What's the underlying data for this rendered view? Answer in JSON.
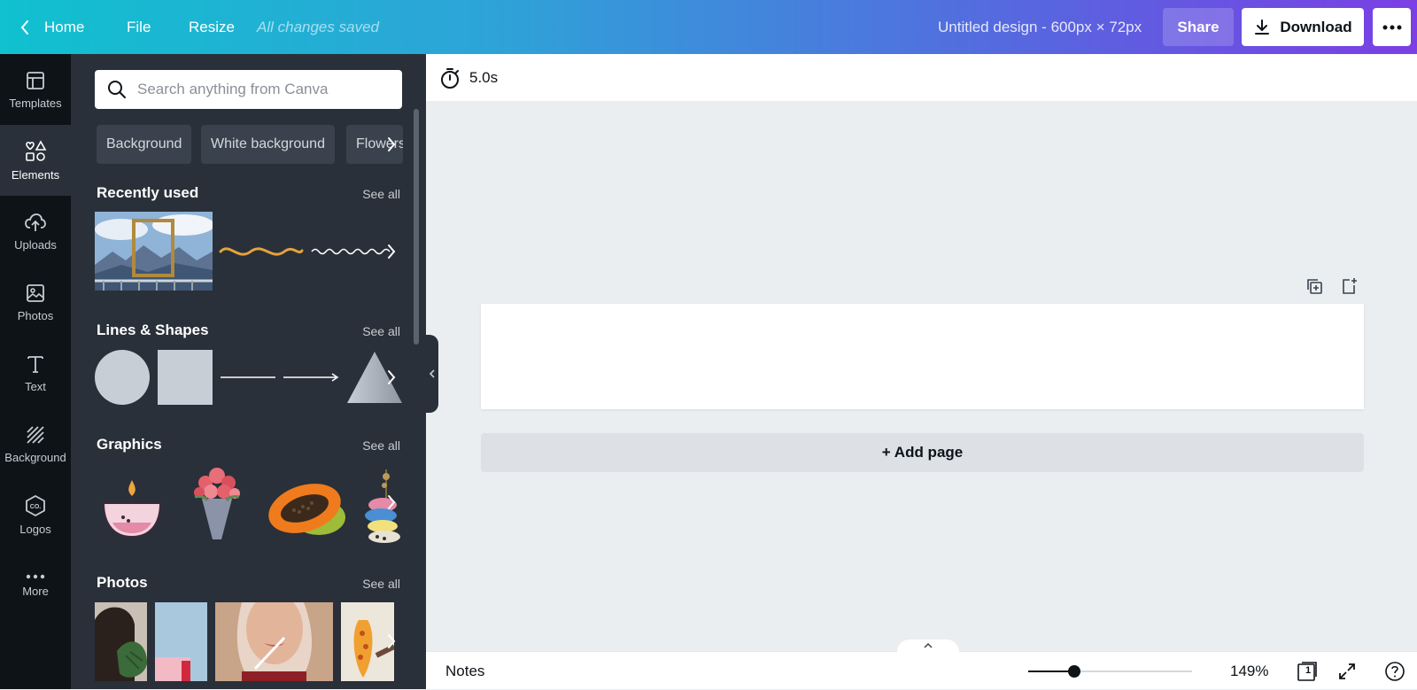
{
  "topbar": {
    "home_label": "Home",
    "file_label": "File",
    "resize_label": "Resize",
    "save_status": "All changes saved",
    "design_title": "Untitled design - 600px × 72px",
    "share_label": "Share",
    "download_label": "Download"
  },
  "rail": {
    "items": [
      {
        "label": "Templates",
        "icon": "templates-icon"
      },
      {
        "label": "Elements",
        "icon": "elements-icon"
      },
      {
        "label": "Uploads",
        "icon": "cloud-upload-icon"
      },
      {
        "label": "Photos",
        "icon": "photo-icon"
      },
      {
        "label": "Text",
        "icon": "text-icon"
      },
      {
        "label": "Background",
        "icon": "background-pattern-icon"
      },
      {
        "label": "Logos",
        "icon": "logo-icon"
      },
      {
        "label": "More",
        "icon": "more-dots-icon"
      }
    ],
    "active": "Elements"
  },
  "panel": {
    "search_placeholder": "Search anything from Canva",
    "chips": [
      "Background",
      "White background",
      "Flowers"
    ],
    "sections": {
      "recent": {
        "title": "Recently used",
        "see_all": "See all"
      },
      "shapes": {
        "title": "Lines & Shapes",
        "see_all": "See all"
      },
      "graphics": {
        "title": "Graphics",
        "see_all": "See all"
      },
      "photos": {
        "title": "Photos",
        "see_all": "See all"
      }
    }
  },
  "timer": {
    "duration": "5.0s"
  },
  "canvas": {
    "add_page_label": "+ Add page"
  },
  "footer": {
    "notes_label": "Notes",
    "zoom_percent": 149,
    "zoom_label": "149%",
    "zoom_fill_fraction": 0.28,
    "page_count": "1"
  },
  "colors": {
    "gradient_start": "#10c1cf",
    "gradient_end": "#7b3fe4",
    "rail_bg": "#0e1318",
    "panel_bg": "#293039",
    "canvas_bg": "#ebeef1"
  }
}
